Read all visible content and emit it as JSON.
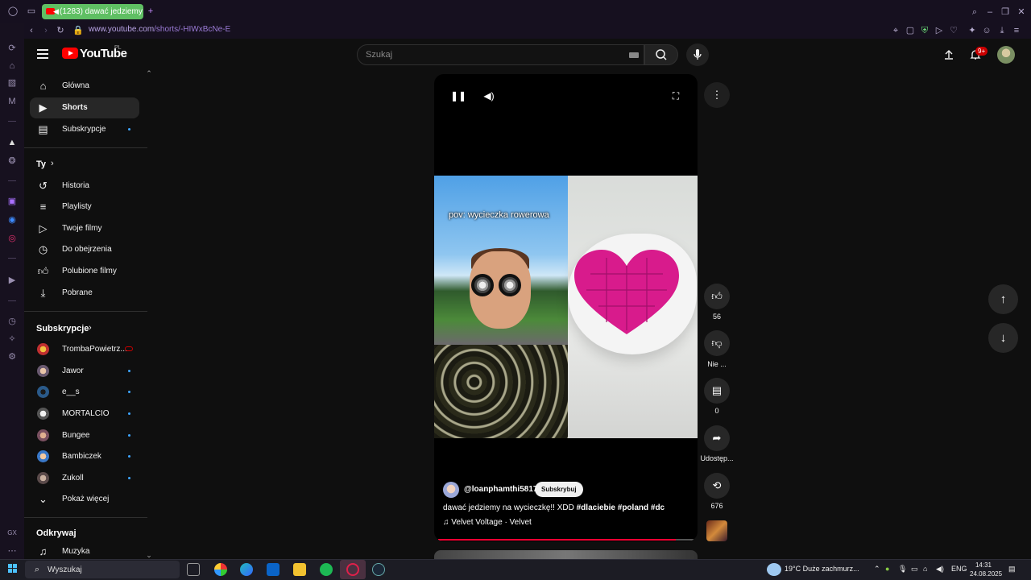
{
  "browser": {
    "tab_title": "(1283) dawać jedziemy",
    "new_tab": "+",
    "url_host": "www.youtube.com",
    "url_path": "/shorts/-HIWxBcNe-E"
  },
  "masthead": {
    "logo_text": "YouTube",
    "region": "PL",
    "search_placeholder": "Szukaj",
    "notif_count": "9+"
  },
  "sidebar": {
    "main": [
      {
        "label": "Główna",
        "icon": "home-icon"
      },
      {
        "label": "Shorts",
        "icon": "shorts-icon",
        "active": true
      },
      {
        "label": "Subskrypcje",
        "icon": "subscriptions-icon"
      }
    ],
    "you_title": "Ty",
    "you": [
      {
        "label": "Historia"
      },
      {
        "label": "Playlisty"
      },
      {
        "label": "Twoje filmy"
      },
      {
        "label": "Do obejrzenia"
      },
      {
        "label": "Polubione filmy"
      },
      {
        "label": "Pobrane"
      }
    ],
    "subs_title": "Subskrypcje",
    "subs": [
      {
        "label": "TrombaPowietrz...",
        "live": true
      },
      {
        "label": "Jawor"
      },
      {
        "label": "e__s"
      },
      {
        "label": "MORTALCIO"
      },
      {
        "label": "Bungee"
      },
      {
        "label": "Bambiczek"
      },
      {
        "label": "Zukoll"
      }
    ],
    "show_more": "Pokaż więcej",
    "explore_title": "Odkrywaj",
    "explore": [
      {
        "label": "Muzyka"
      }
    ]
  },
  "short": {
    "overlay_text": "pov: wycieczka rowerowa",
    "channel": "@loanphamthi5817",
    "subscribe": "Subskrybuj",
    "desc_text": "dawać jedziemy na wycieczkę!! XDD ",
    "desc_tags": "#dlaciebie #poland #dc",
    "music": "Velvet Voltage · Velvet",
    "progress": 0.93
  },
  "actions": {
    "likes": "56",
    "dislike": "Nie ...",
    "comments": "0",
    "share": "Udostęp...",
    "remix": "676"
  },
  "taskbar": {
    "search": "Wyszukaj",
    "weather": "19°C  Duże zachmurz...",
    "lang": "ENG",
    "time": "14:31",
    "date": "24.08.2025"
  },
  "colors": {
    "accent_red": "#ff0000",
    "tab_green": "#5fbf63",
    "link_blue": "#3ea6ff"
  }
}
